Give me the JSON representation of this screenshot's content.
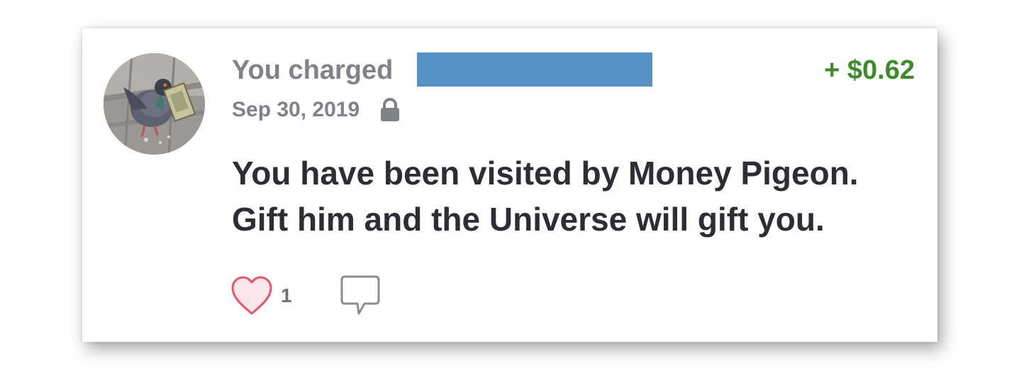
{
  "transaction": {
    "header_prefix": "You charged",
    "amount": "+ $0.62",
    "date": "Sep 30, 2019",
    "message_line1": "You have been visited by Money Pigeon.",
    "message_line2": "Gift him and the Universe will gift you.",
    "like_count": "1"
  },
  "colors": {
    "amount_green": "#3d8c2a",
    "redaction_blue": "#5592c6",
    "meta_gray": "#808289",
    "heart_pink": "#e8556b"
  },
  "icons": {
    "privacy": "lock-icon",
    "like": "heart-icon",
    "comment": "comment-bubble-icon"
  }
}
